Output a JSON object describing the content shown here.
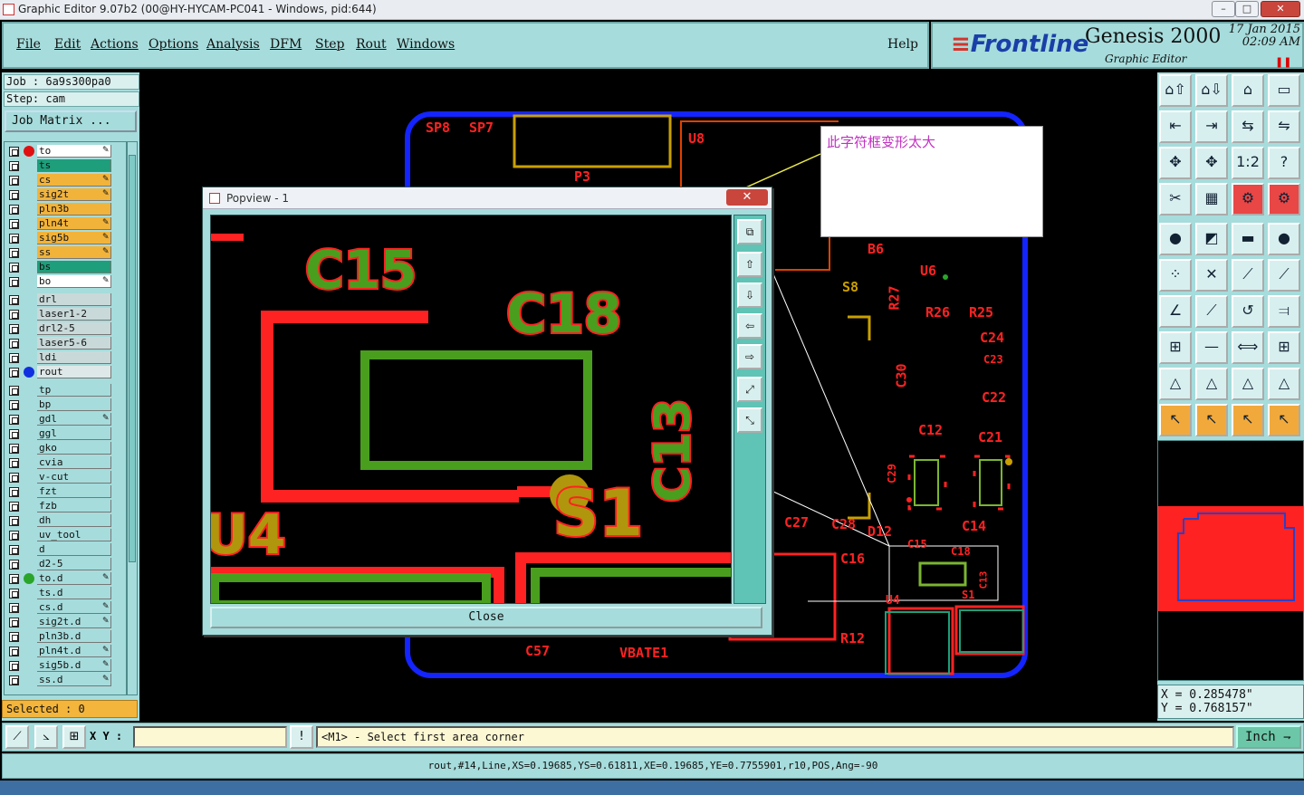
{
  "window": {
    "title": "Graphic Editor 9.07b2 (00@HY-HYCAM-PC041 - Windows, pid:644)",
    "min": "–",
    "max": "□",
    "close": "✕"
  },
  "menu": {
    "items": [
      "File",
      "Edit",
      "Actions",
      "Options",
      "Analysis",
      "DFM",
      "Step",
      "Rout",
      "Windows"
    ],
    "help": "Help"
  },
  "brand": {
    "logo_bars": "≡",
    "logo": "Frontline",
    "name": "Genesis 2000",
    "subtitle": "Graphic Editor",
    "date": "17 Jan 2015",
    "time": "02:09 AM",
    "pause": "❚❚"
  },
  "job": {
    "job_line": "Job : 6a9s300pa0",
    "step_line": "Step: cam",
    "matrix_button": "Job Matrix ..."
  },
  "layers": [
    {
      "name": "to",
      "color": "#ffffff",
      "dot": "#e01010",
      "pen": "✎"
    },
    {
      "name": "ts",
      "color": "#1e9e7a"
    },
    {
      "name": "cs",
      "color": "#f2b33a",
      "pen": "✎"
    },
    {
      "name": "sig2t",
      "color": "#f2b33a",
      "pen": "✎"
    },
    {
      "name": "pln3b",
      "color": "#f2b33a"
    },
    {
      "name": "pln4t",
      "color": "#f2b33a",
      "pen": "✎"
    },
    {
      "name": "sig5b",
      "color": "#f2b33a",
      "pen": "✎"
    },
    {
      "name": "ss",
      "color": "#f2b33a",
      "pen": "✎"
    },
    {
      "name": "bs",
      "color": "#1e9e7a"
    },
    {
      "name": "bo",
      "color": "#ffffff",
      "pen": "✎"
    },
    {
      "name": "drl",
      "color": "#c9d9d9",
      "gap": true
    },
    {
      "name": "laser1-2",
      "color": "#c9d9d9"
    },
    {
      "name": "drl2-5",
      "color": "#c9d9d9"
    },
    {
      "name": "laser5-6",
      "color": "#c9d9d9"
    },
    {
      "name": "ldi",
      "color": "#c9d9d9"
    },
    {
      "name": "rout",
      "color": "#dfe8e8",
      "dot": "#1030e0"
    },
    {
      "name": "tp",
      "color": "#a6dcdc",
      "gap": true
    },
    {
      "name": "bp",
      "color": "#a6dcdc"
    },
    {
      "name": "gdl",
      "color": "#a6dcdc",
      "pen": "✎"
    },
    {
      "name": "ggl",
      "color": "#a6dcdc"
    },
    {
      "name": "gko",
      "color": "#a6dcdc"
    },
    {
      "name": "cvia",
      "color": "#a6dcdc"
    },
    {
      "name": "v-cut",
      "color": "#a6dcdc"
    },
    {
      "name": "fzt",
      "color": "#a6dcdc"
    },
    {
      "name": "fzb",
      "color": "#a6dcdc"
    },
    {
      "name": "dh",
      "color": "#a6dcdc"
    },
    {
      "name": "uv_tool",
      "color": "#a6dcdc"
    },
    {
      "name": "d",
      "color": "#a6dcdc"
    },
    {
      "name": "d2-5",
      "color": "#a6dcdc"
    },
    {
      "name": "to.d",
      "color": "#a6dcdc",
      "dot": "#2aa52a",
      "pen": "✎"
    },
    {
      "name": "ts.d",
      "color": "#a6dcdc"
    },
    {
      "name": "cs.d",
      "color": "#a6dcdc",
      "pen": "✎"
    },
    {
      "name": "sig2t.d",
      "color": "#a6dcdc",
      "pen": "✎"
    },
    {
      "name": "pln3b.d",
      "color": "#a6dcdc"
    },
    {
      "name": "pln4t.d",
      "color": "#a6dcdc",
      "pen": "✎"
    },
    {
      "name": "sig5b.d",
      "color": "#a6dcdc",
      "pen": "✎"
    },
    {
      "name": "ss.d",
      "color": "#a6dcdc",
      "pen": "✎"
    }
  ],
  "selected": "Selected : 0",
  "annotation": "此字符框变形太大",
  "popview": {
    "title": "Popview - 1",
    "close_x": "✕",
    "close_button": "Close",
    "labels": {
      "c15": "C15",
      "c18": "C18",
      "c13": "C13",
      "s1": "S1",
      "u4": "U4"
    },
    "tools": [
      "⧉",
      "⇧",
      "⇩",
      "⇦",
      "⇨",
      "⤢",
      "⤡"
    ]
  },
  "board_labels": [
    {
      "t": "SP8"
    },
    {
      "t": "SP7"
    },
    {
      "t": "U8"
    },
    {
      "t": "P3"
    },
    {
      "t": "B6"
    },
    {
      "t": "U6"
    },
    {
      "t": "R27"
    },
    {
      "t": "R26"
    },
    {
      "t": "R25"
    },
    {
      "t": "C24"
    },
    {
      "t": "C23"
    },
    {
      "t": "C30"
    },
    {
      "t": "C22"
    },
    {
      "t": "C12"
    },
    {
      "t": "C21"
    },
    {
      "t": "C29"
    },
    {
      "t": "C27"
    },
    {
      "t": "C28"
    },
    {
      "t": "D12"
    },
    {
      "t": "C14"
    },
    {
      "t": "C16"
    },
    {
      "t": "C15"
    },
    {
      "t": "C18"
    },
    {
      "t": "C13"
    },
    {
      "t": "U4"
    },
    {
      "t": "S1"
    },
    {
      "t": "R12"
    },
    {
      "t": "C57"
    },
    {
      "t": "VBATE1"
    },
    {
      "t": "S8"
    }
  ],
  "tools": {
    "rows": [
      [
        "⌂⇧",
        "⌂⇩",
        "⌂",
        "▭"
      ],
      [
        "⇤",
        "⇥",
        "⇆",
        "⇋"
      ],
      [
        "✥",
        "✥",
        "1:2",
        "?"
      ],
      [
        "✂",
        "▦",
        "⚙",
        "⚙"
      ],
      [
        "●",
        "◩",
        "▬",
        "●"
      ],
      [
        "⁘",
        "✕",
        "⟋",
        "⟋"
      ],
      [
        "∠",
        "⟋",
        "↺",
        "⫤"
      ],
      [
        "⊞",
        "—",
        "⟺",
        "⊞"
      ],
      [
        "△",
        "△",
        "△",
        "△"
      ],
      [
        "↖",
        "↖",
        "↖",
        "↖"
      ]
    ]
  },
  "coords": {
    "x": "X = 0.285478\"",
    "y": "Y = 0.768157\""
  },
  "cmd": {
    "xy_label": "X Y :",
    "xy_value": "",
    "prompt": "<M1> - Select first area corner",
    "units": "Inch ⇁",
    "warn": "!"
  },
  "status": "rout,#14,Line,XS=0.19685,YS=0.61811,XE=0.19685,YE=0.7755901,r10,POS,Ang=-90"
}
